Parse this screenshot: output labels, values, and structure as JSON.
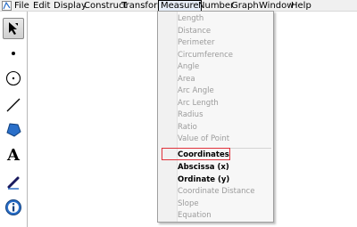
{
  "menubar": {
    "items": [
      {
        "label": "File"
      },
      {
        "label": "Edit"
      },
      {
        "label": "Display"
      },
      {
        "label": "Construct"
      },
      {
        "label": "Transform"
      },
      {
        "label": "Measure"
      },
      {
        "label": "Number"
      },
      {
        "label": "Graph"
      },
      {
        "label": "Window"
      },
      {
        "label": "Help"
      }
    ],
    "active": "Measure"
  },
  "toolbox": {
    "tools": [
      {
        "name": "arrow-select-tool",
        "selected": true
      },
      {
        "name": "point-tool"
      },
      {
        "name": "compass-circle-tool"
      },
      {
        "name": "straightedge-tool"
      },
      {
        "name": "polygon-tool"
      },
      {
        "name": "text-tool",
        "label": "A"
      },
      {
        "name": "marker-tool"
      },
      {
        "name": "information-tool",
        "label": "i"
      }
    ]
  },
  "measure_menu": {
    "group1": [
      {
        "label": "Length",
        "enabled": false
      },
      {
        "label": "Distance",
        "enabled": false
      },
      {
        "label": "Perimeter",
        "enabled": false
      },
      {
        "label": "Circumference",
        "enabled": false
      },
      {
        "label": "Angle",
        "enabled": false
      },
      {
        "label": "Area",
        "enabled": false
      },
      {
        "label": "Arc Angle",
        "enabled": false
      },
      {
        "label": "Arc Length",
        "enabled": false
      },
      {
        "label": "Radius",
        "enabled": false
      },
      {
        "label": "Ratio",
        "enabled": false
      },
      {
        "label": "Value of Point",
        "enabled": false
      }
    ],
    "group2": [
      {
        "label": "Coordinates",
        "enabled": true,
        "highlighted": true
      },
      {
        "label": "Abscissa (x)",
        "enabled": true
      },
      {
        "label": "Ordinate (y)",
        "enabled": true
      },
      {
        "label": "Coordinate Distance",
        "enabled": false
      },
      {
        "label": "Slope",
        "enabled": false
      },
      {
        "label": "Equation",
        "enabled": false
      }
    ]
  },
  "colors": {
    "highlight_box": "#e0313a",
    "disabled_text": "#9b9b9b",
    "menu_bg": "#f7f7f7"
  }
}
